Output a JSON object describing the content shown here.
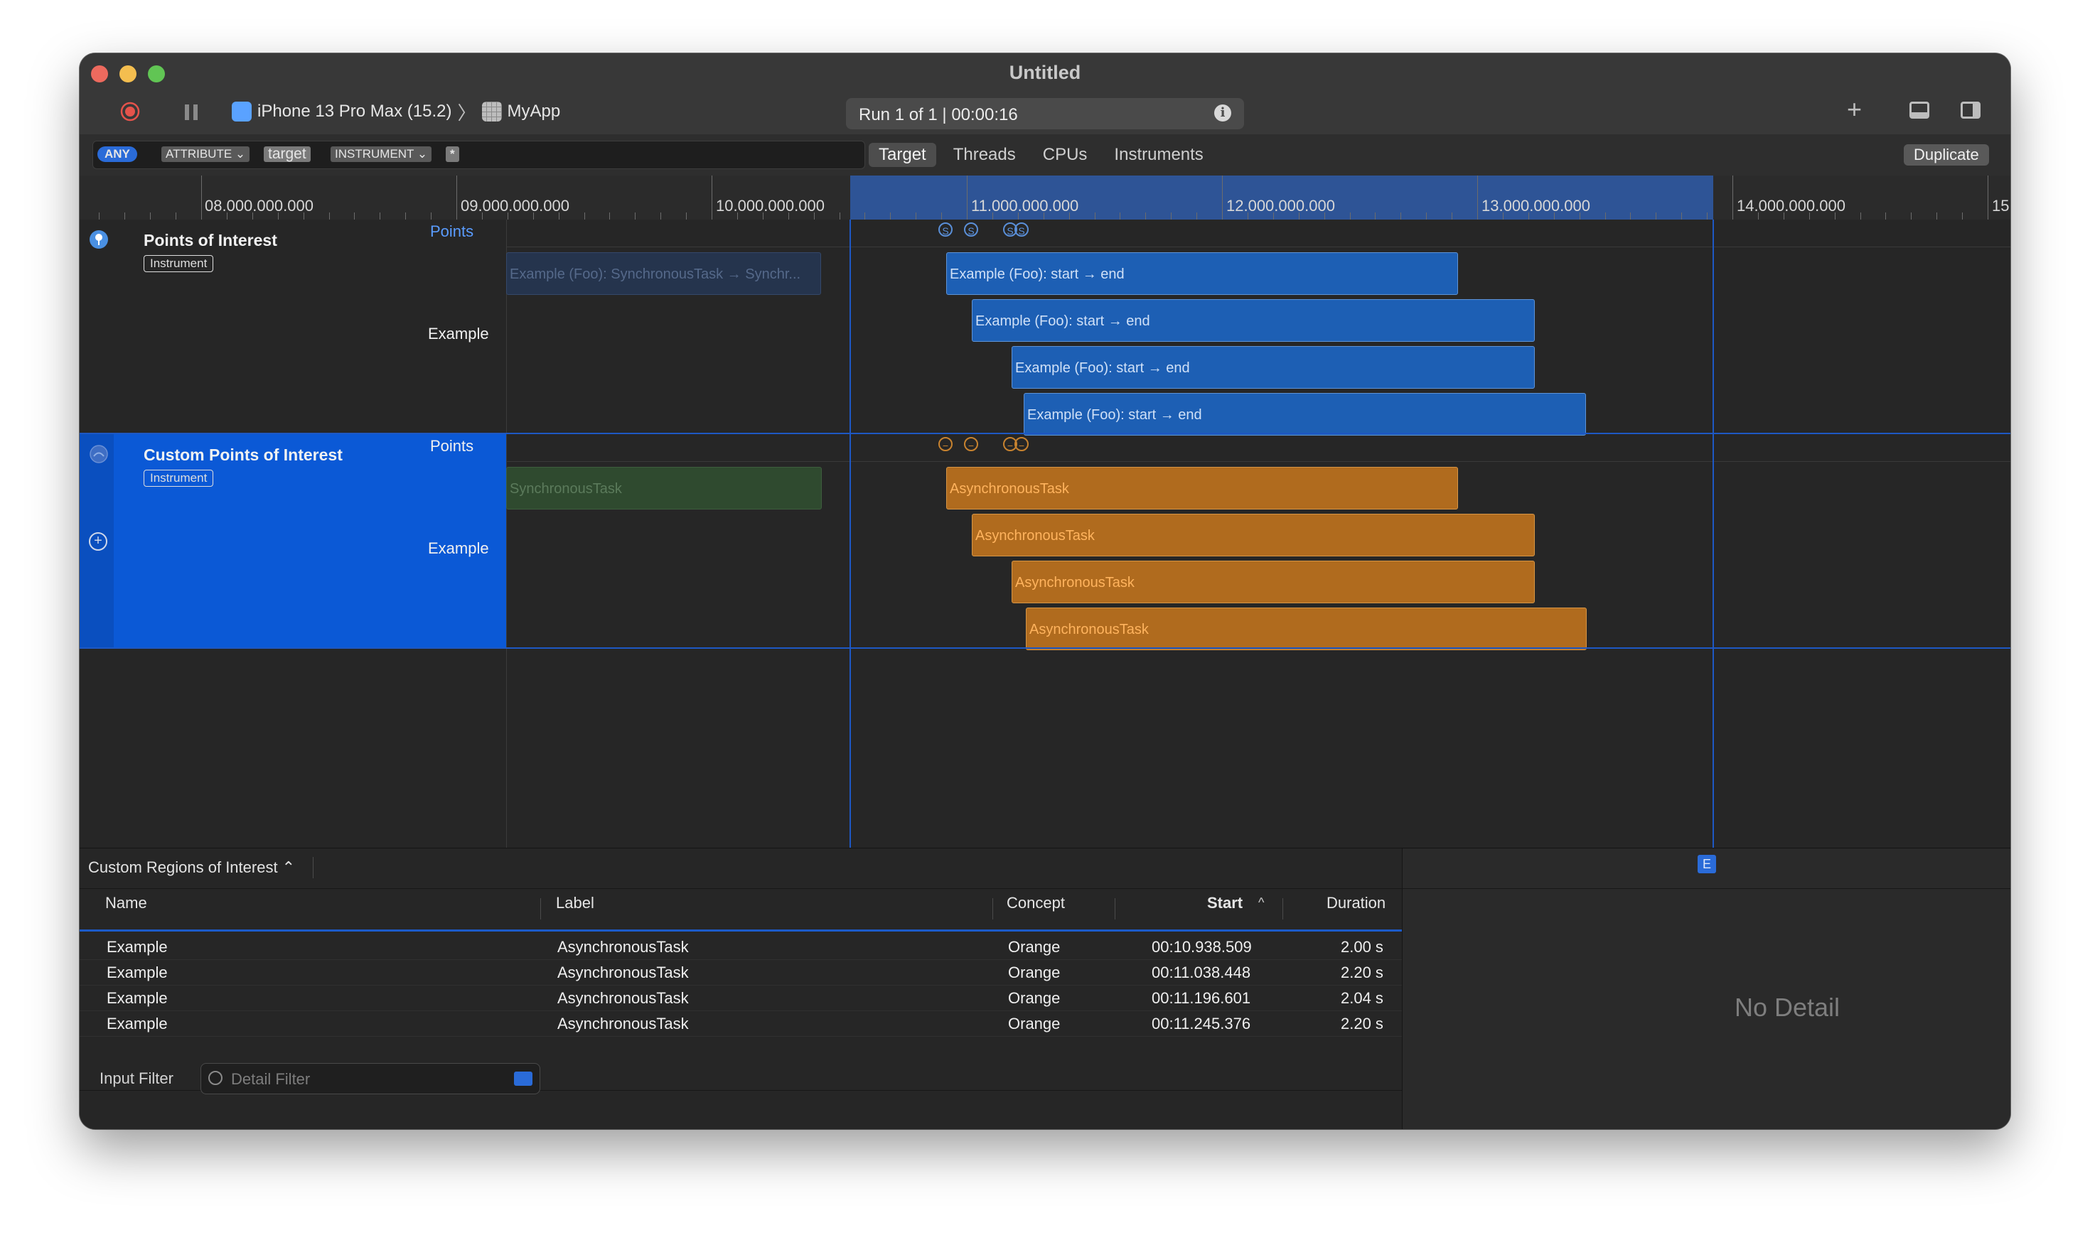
{
  "window": {
    "title": "Untitled"
  },
  "toolbar": {
    "device": "iPhone 13 Pro Max (15.2)",
    "app": "MyApp",
    "run_text": "Run 1 of 1  |  00:00:16"
  },
  "filter": {
    "tokens": {
      "any": "ANY",
      "attribute": "ATTRIBUTE ⌄",
      "target": "target",
      "instrument": "INSTRUMENT ⌄",
      "star": "*"
    }
  },
  "scope_tabs": [
    "Target",
    "Threads",
    "CPUs",
    "Instruments"
  ],
  "duplicate_label": "Duplicate",
  "ruler_labels": [
    "08.000.000.000",
    "09.000.000.000",
    "10.000.000.000",
    "11.000.000.000",
    "12.000.000.000",
    "13.000.000.000",
    "14.000.000.000",
    "15"
  ],
  "tracks": [
    {
      "title": "Points of Interest",
      "badge": "Instrument",
      "points_label": "Points",
      "lane_label": "Example",
      "dim_bar": "Example (Foo): SynchronousTask → Synchr...",
      "bars": [
        "Example (Foo): start → end",
        "Example (Foo): start → end",
        "Example (Foo): start → end",
        "Example (Foo): start → end"
      ],
      "signpost_glyph": "S"
    },
    {
      "title": "Custom Points of Interest",
      "badge": "Instrument",
      "points_label": "Points",
      "lane_label": "Example",
      "dim_bar": "SynchronousTask",
      "bars": [
        "AsynchronousTask",
        "AsynchronousTask",
        "AsynchronousTask",
        "AsynchronousTask"
      ],
      "signpost_glyph": "−"
    }
  ],
  "detail": {
    "region_picker": "Custom Regions of Interest ⌃",
    "columns": {
      "name": "Name",
      "label": "Label",
      "concept": "Concept",
      "start": "Start",
      "start_sort": "^",
      "duration": "Duration"
    },
    "rows": [
      {
        "name": "Example",
        "label": "AsynchronousTask",
        "concept": "Orange",
        "start": "00:10.938.509",
        "duration": "2.00 s"
      },
      {
        "name": "Example",
        "label": "AsynchronousTask",
        "concept": "Orange",
        "start": "00:11.038.448",
        "duration": "2.20 s"
      },
      {
        "name": "Example",
        "label": "AsynchronousTask",
        "concept": "Orange",
        "start": "00:11.196.601",
        "duration": "2.04 s"
      },
      {
        "name": "Example",
        "label": "AsynchronousTask",
        "concept": "Orange",
        "start": "00:11.245.376",
        "duration": "2.20 s"
      }
    ],
    "input_filter_label": "Input Filter",
    "detail_filter_placeholder": "Detail Filter",
    "extended_badge": "E",
    "no_detail": "No Detail"
  },
  "colors": {
    "accent": "#0b59d6",
    "blue_bar": "#1d5fb4",
    "orange_bar": "#b06b1e"
  }
}
